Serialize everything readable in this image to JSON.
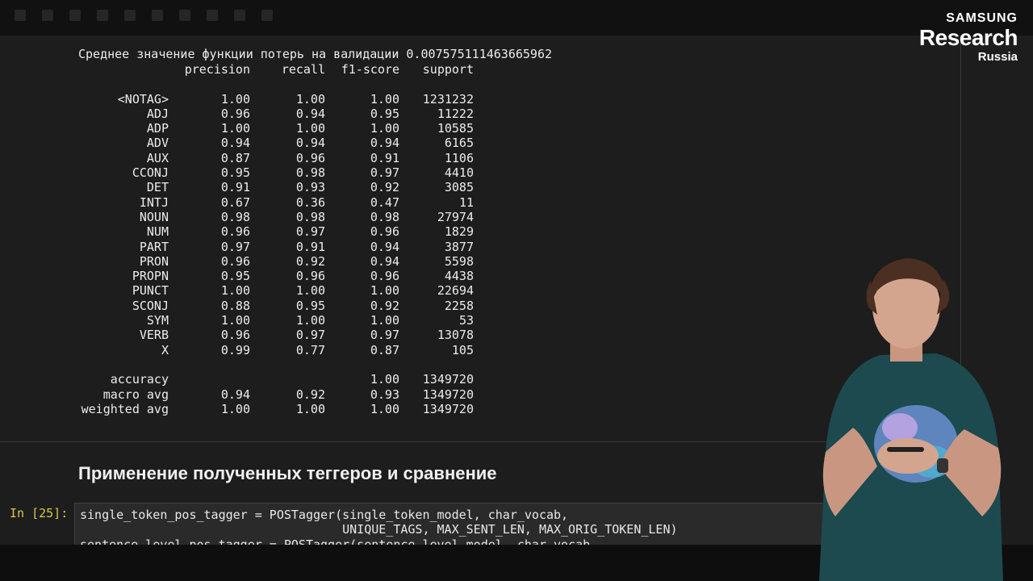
{
  "brand": {
    "line1": "SAMSUNG",
    "line2": "Research",
    "line3": "Russia"
  },
  "output": {
    "loss_line": "Среднее значение функции потерь на валидации 0.007575111463665962",
    "headers": [
      "",
      "precision",
      "recall",
      "f1-score",
      "support"
    ],
    "rows": [
      [
        "<NOTAG>",
        "1.00",
        "1.00",
        "1.00",
        "1231232"
      ],
      [
        "ADJ",
        "0.96",
        "0.94",
        "0.95",
        "11222"
      ],
      [
        "ADP",
        "1.00",
        "1.00",
        "1.00",
        "10585"
      ],
      [
        "ADV",
        "0.94",
        "0.94",
        "0.94",
        "6165"
      ],
      [
        "AUX",
        "0.87",
        "0.96",
        "0.91",
        "1106"
      ],
      [
        "CCONJ",
        "0.95",
        "0.98",
        "0.97",
        "4410"
      ],
      [
        "DET",
        "0.91",
        "0.93",
        "0.92",
        "3085"
      ],
      [
        "INTJ",
        "0.67",
        "0.36",
        "0.47",
        "11"
      ],
      [
        "NOUN",
        "0.98",
        "0.98",
        "0.98",
        "27974"
      ],
      [
        "NUM",
        "0.96",
        "0.97",
        "0.96",
        "1829"
      ],
      [
        "PART",
        "0.97",
        "0.91",
        "0.94",
        "3877"
      ],
      [
        "PRON",
        "0.96",
        "0.92",
        "0.94",
        "5598"
      ],
      [
        "PROPN",
        "0.95",
        "0.96",
        "0.96",
        "4438"
      ],
      [
        "PUNCT",
        "1.00",
        "1.00",
        "1.00",
        "22694"
      ],
      [
        "SCONJ",
        "0.88",
        "0.95",
        "0.92",
        "2258"
      ],
      [
        "SYM",
        "1.00",
        "1.00",
        "1.00",
        "53"
      ],
      [
        "VERB",
        "0.96",
        "0.97",
        "0.97",
        "13078"
      ],
      [
        "X",
        "0.99",
        "0.77",
        "0.87",
        "105"
      ]
    ],
    "summary": [
      [
        "accuracy",
        "",
        "",
        "1.00",
        "1349720"
      ],
      [
        "macro avg",
        "0.94",
        "0.92",
        "0.93",
        "1349720"
      ],
      [
        "weighted avg",
        "1.00",
        "1.00",
        "1.00",
        "1349720"
      ]
    ],
    "highlight_color": "#27c8e6"
  },
  "section_heading": "Применение полученных теггеров и сравнение",
  "cell": {
    "prompt": "In [25]:",
    "code": "single_token_pos_tagger = POSTagger(single_token_model, char_vocab,\n                                    UNIQUE_TAGS, MAX_SENT_LEN, MAX_ORIG_TOKEN_LEN)\nsentence_level_pos_tagger = POSTagger(sentence_level_model, char_vocab,"
  }
}
